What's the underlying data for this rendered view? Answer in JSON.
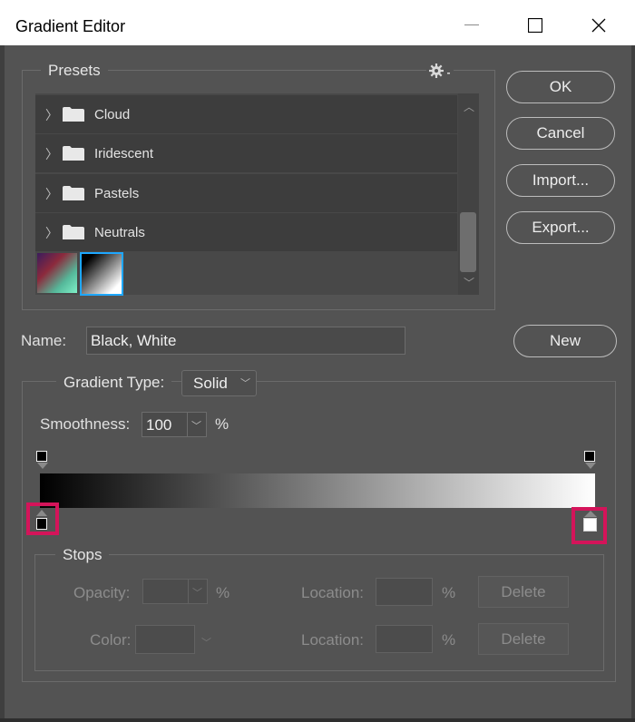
{
  "window": {
    "title": "Gradient Editor",
    "controls": [
      "minimize",
      "maximize",
      "close"
    ]
  },
  "presets": {
    "legend": "Presets",
    "menu_icon": "gear-icon",
    "folders": [
      {
        "label": "Cloud"
      },
      {
        "label": "Iridescent"
      },
      {
        "label": "Pastels"
      },
      {
        "label": "Neutrals"
      }
    ],
    "swatches": [
      "iridescent-swatch",
      "black-white-swatch"
    ],
    "selected_swatch": "black-white-swatch"
  },
  "buttons": {
    "ok": "OK",
    "cancel": "Cancel",
    "import": "Import...",
    "export": "Export...",
    "new": "New"
  },
  "name": {
    "label": "Name:",
    "value": "Black, White"
  },
  "gradient": {
    "type_label": "Gradient Type:",
    "type_value": "Solid",
    "smoothness_label": "Smoothness:",
    "smoothness_value": "100",
    "smoothness_unit": "%",
    "colors": {
      "start": "#000000",
      "end": "#ffffff",
      "highlight": "#d4145a",
      "selection": "#1ea7ff"
    }
  },
  "stops": {
    "legend": "Stops",
    "opacity_label": "Opacity:",
    "opacity_unit": "%",
    "location_label_1": "Location:",
    "location_unit_1": "%",
    "delete_label_1": "Delete",
    "color_label": "Color:",
    "location_label_2": "Location:",
    "location_unit_2": "%",
    "delete_label_2": "Delete"
  }
}
